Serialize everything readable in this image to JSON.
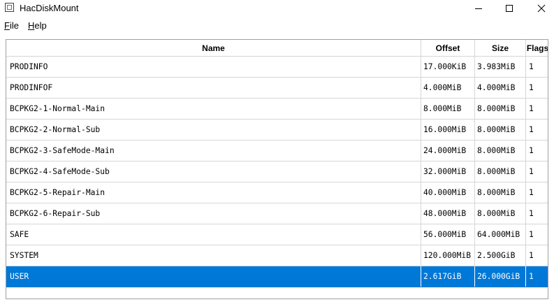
{
  "window": {
    "title": "HacDiskMount"
  },
  "menu": {
    "file_acc": "F",
    "file_rest": "ile",
    "help_acc": "H",
    "help_rest": "elp"
  },
  "table": {
    "columns": [
      "Name",
      "Offset",
      "Size",
      "Flags"
    ],
    "selected_row": 10,
    "rows": [
      {
        "name": "PRODINFO",
        "offset": "17.000KiB",
        "size": "3.983MiB",
        "flags": "1"
      },
      {
        "name": "PRODINFOF",
        "offset": "4.000MiB",
        "size": "4.000MiB",
        "flags": "1"
      },
      {
        "name": "BCPKG2-1-Normal-Main",
        "offset": "8.000MiB",
        "size": "8.000MiB",
        "flags": "1"
      },
      {
        "name": "BCPKG2-2-Normal-Sub",
        "offset": "16.000MiB",
        "size": "8.000MiB",
        "flags": "1"
      },
      {
        "name": "BCPKG2-3-SafeMode-Main",
        "offset": "24.000MiB",
        "size": "8.000MiB",
        "flags": "1"
      },
      {
        "name": "BCPKG2-4-SafeMode-Sub",
        "offset": "32.000MiB",
        "size": "8.000MiB",
        "flags": "1"
      },
      {
        "name": "BCPKG2-5-Repair-Main",
        "offset": "40.000MiB",
        "size": "8.000MiB",
        "flags": "1"
      },
      {
        "name": "BCPKG2-6-Repair-Sub",
        "offset": "48.000MiB",
        "size": "8.000MiB",
        "flags": "1"
      },
      {
        "name": "SAFE",
        "offset": "56.000MiB",
        "size": "64.000MiB",
        "flags": "1"
      },
      {
        "name": "SYSTEM",
        "offset": "120.000MiB",
        "size": "2.500GiB",
        "flags": "1"
      },
      {
        "name": "USER",
        "offset": "2.617GiB",
        "size": "26.000GiB",
        "flags": "1"
      }
    ]
  },
  "colors": {
    "selection": "#0078d7",
    "grid": "#d6d6d6"
  }
}
